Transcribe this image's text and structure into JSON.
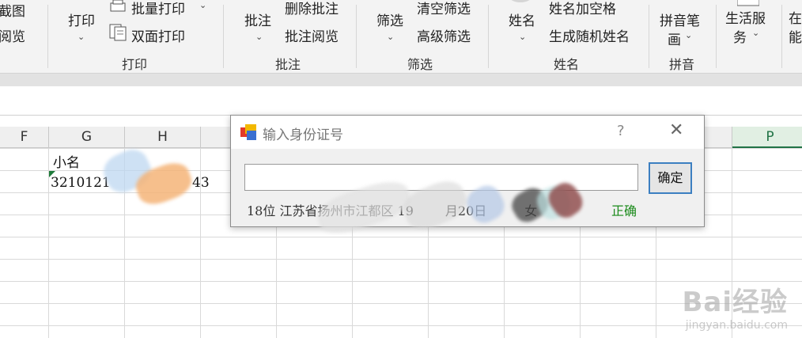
{
  "ribbon": {
    "items": {
      "screenshot_top": "截图",
      "view_bottom": "阅览",
      "print": "打印",
      "batch_print": "批量打印",
      "duplex_print": "双面打印",
      "comment": "批注",
      "delete_comment": "删除批注",
      "comment_view": "批注阅览",
      "filter": "筛选",
      "clear_filter": "清空筛选",
      "advanced_filter": "高级筛选",
      "name": "姓名",
      "name_add_space": "姓名加空格",
      "generate_random_name": "生成随机姓名",
      "pinyin_strokes_1": "拼音笔",
      "pinyin_strokes_2": "画",
      "life_service_1": "生活服",
      "life_service_2": "务",
      "cut_1": "在",
      "cut_2": "能"
    },
    "groups": {
      "print": "打印",
      "comment": "批注",
      "filter": "筛选",
      "name": "姓名",
      "pinyin": "拼音"
    }
  },
  "grid": {
    "columns": [
      "F",
      "G",
      "H",
      "P"
    ],
    "cells": {
      "g1": "小名",
      "g2": "3210121",
      "h2_tail": "43"
    }
  },
  "dialog": {
    "title": "输入身份证号",
    "help": "?",
    "close": "✕",
    "input_value": "",
    "ok_label": "确定",
    "info_text": "18位  江苏省扬州市江都区  19",
    "info_tail": "月20日",
    "gender": "女",
    "status": "正确"
  },
  "watermark": {
    "main": "Bai经验",
    "sub": "jingyan.baidu.com"
  }
}
